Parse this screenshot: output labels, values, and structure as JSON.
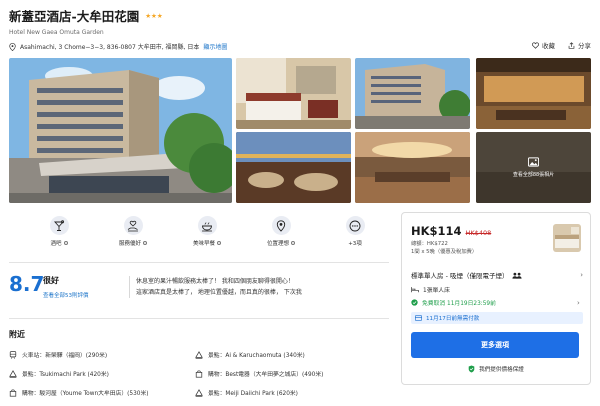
{
  "hotel": {
    "name": "新蓋亞酒店-大牟田花園",
    "stars": "★★★",
    "name_en": "Hotel New Gaea Omuta Garden",
    "address": "Asahimachi, 3 Chome−3−3, 836-0807 大牟田市, 福岡縣, 日本",
    "map_link": "顯示地圖"
  },
  "actions": {
    "save": "收藏",
    "share": "分享"
  },
  "gallery": {
    "more_photos": "查看全部88張相片"
  },
  "amenities": [
    {
      "icon": "cocktail-icon",
      "label": "酒吧"
    },
    {
      "icon": "heart-hand-icon",
      "label": "服務優好"
    },
    {
      "icon": "breakfast-icon",
      "label": "美味早餐"
    },
    {
      "icon": "location-badge-icon",
      "label": "位置理想"
    },
    {
      "icon": "more-icon",
      "label": "+3項"
    }
  ],
  "rating": {
    "score": "8.7",
    "label": "很好",
    "reviews_link": "查看全部53則評價",
    "review_line1": "休息室的果汁暢飲服務太棒了！ 我和四個朋友聊得很開心！",
    "review_line2": "這家酒店真是太棒了， 地理位置優越，而且真的很棒， 下次我"
  },
  "nearby": {
    "title": "附近",
    "items": [
      {
        "icon": "train-icon",
        "text": "火車站：新榮驛（福岡）(290米)"
      },
      {
        "icon": "landmark-icon",
        "text": "景點：Ai & Karuchaomuta (340米)"
      },
      {
        "icon": "landmark-icon",
        "text": "景點：Tsukimachi Park (420米)"
      },
      {
        "icon": "shopping-bag-icon",
        "text": "購物：Best電器（大牟田夢之城店）(490米)"
      },
      {
        "icon": "shopping-bag-icon",
        "text": "購物：駿河屋（Youme Town大牟田店）(530米)"
      },
      {
        "icon": "landmark-icon",
        "text": "景點：Meiji Daiichi Park (620米)"
      }
    ]
  },
  "booking": {
    "price": "HK$114",
    "old_price": "HK$408",
    "total": "總額：HK$722",
    "per_night": "1間 x 5晚（優惠及稅加費）",
    "room_type": "標準單人房 - 吸煙（僅限電子煙）",
    "bed": "1張單人床",
    "free_cancel": "免費取消 11月19日23:59前",
    "pay_later": "11月17日前無需付款",
    "cta": "更多選項",
    "guarantee": "我們提供價格保證"
  },
  "colors": {
    "accent": "#1e6fe6",
    "score": "#1a6fd0",
    "star": "#f5a623",
    "strike": "#c62828",
    "green": "#1e9e4a"
  }
}
